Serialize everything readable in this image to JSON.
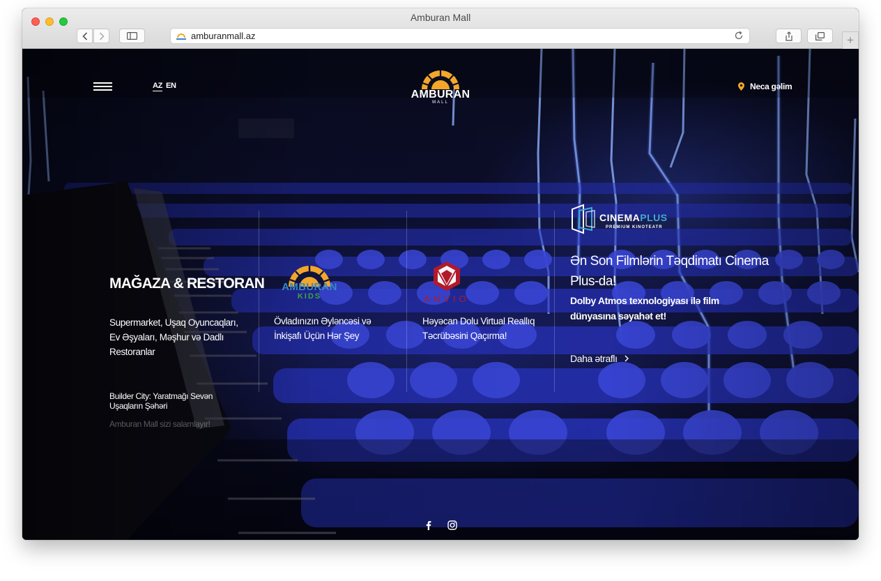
{
  "browser": {
    "window_title": "Amburan Mall",
    "url": "amburanmall.az"
  },
  "header": {
    "languages": [
      "AZ",
      "EN"
    ],
    "active_language": "AZ",
    "logo": {
      "word": "AMBURAN",
      "sub": "MALL"
    },
    "directions_label": "Neca gəlim"
  },
  "columns": {
    "store": {
      "title": "MAĞAZA & RESTORAN",
      "description": "Supermarket, Uşaq Oyuncaqları, Ev Əşyaları, Məşhur və Dadlı Restoranlar",
      "builder_city": "Builder City: Yaratmağı Sevən Uşaqların Şəhəri",
      "welcome": "Amburan Mall sizi salamlayır!"
    },
    "kids": {
      "logo": {
        "word": "AMBURAN",
        "sub": "KIDS"
      },
      "description": "Övladınızın Əyləncəsi və İnkişafı Üçün Hər Şey"
    },
    "anvio": {
      "logo": {
        "word": "ANVIO"
      },
      "description": "Həyəcan Dolu Virtual Reallıq Təcrübəsini Qaçırma!"
    },
    "cinema": {
      "logo": {
        "word_a": "CINEMA",
        "word_b": "PLUS",
        "sub": "PREMIUM KINOTEATR"
      },
      "title": "Ən Son Filmlərin Təqdimatı Cinema Plus-da!",
      "subtitle": "Dolby Atmos texnologiyası ilə film dünyasına səyahət et!",
      "more_label": "Daha ətraflı"
    }
  },
  "social": [
    "facebook-icon",
    "instagram-icon"
  ],
  "colors": {
    "brand_orange": "#f2a62a",
    "anvio_red": "#b11a2b",
    "cinema_cyan": "#3fa9d6",
    "kids_blue": "#3a86c8",
    "kids_green": "#3ba44a"
  }
}
